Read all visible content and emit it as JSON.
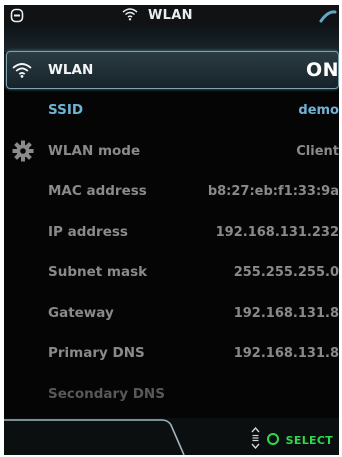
{
  "status_bar": {
    "title": "WLAN",
    "left_icon": "device-icon",
    "title_icon": "wifi-icon",
    "right_icon": "handset-icon"
  },
  "rows": [
    {
      "label": "WLAN",
      "value": "ON",
      "icon": "wifi-icon",
      "state": "selected"
    },
    {
      "label": "SSID",
      "value": "demo",
      "state": "highlight"
    },
    {
      "label": "WLAN mode",
      "value": "Client",
      "icon": "gear-icon"
    },
    {
      "label": "MAC address",
      "value": "b8:27:eb:f1:33:9a"
    },
    {
      "label": "IP address",
      "value": "192.168.131.232"
    },
    {
      "label": "Subnet mask",
      "value": "255.255.255.0"
    },
    {
      "label": "Gateway",
      "value": "192.168.131.8"
    },
    {
      "label": "Primary DNS",
      "value": "192.168.131.8"
    },
    {
      "label": "Secondary DNS",
      "value": "",
      "state": "dim"
    }
  ],
  "footer": {
    "select_label": "SELECT",
    "scroll_icon": "up-down-icon",
    "ok_icon": "circle-icon"
  },
  "colors": {
    "accent_blue": "#6fb3d6",
    "select_green": "#2fd94a",
    "label_gray": "#8a8a8a"
  }
}
